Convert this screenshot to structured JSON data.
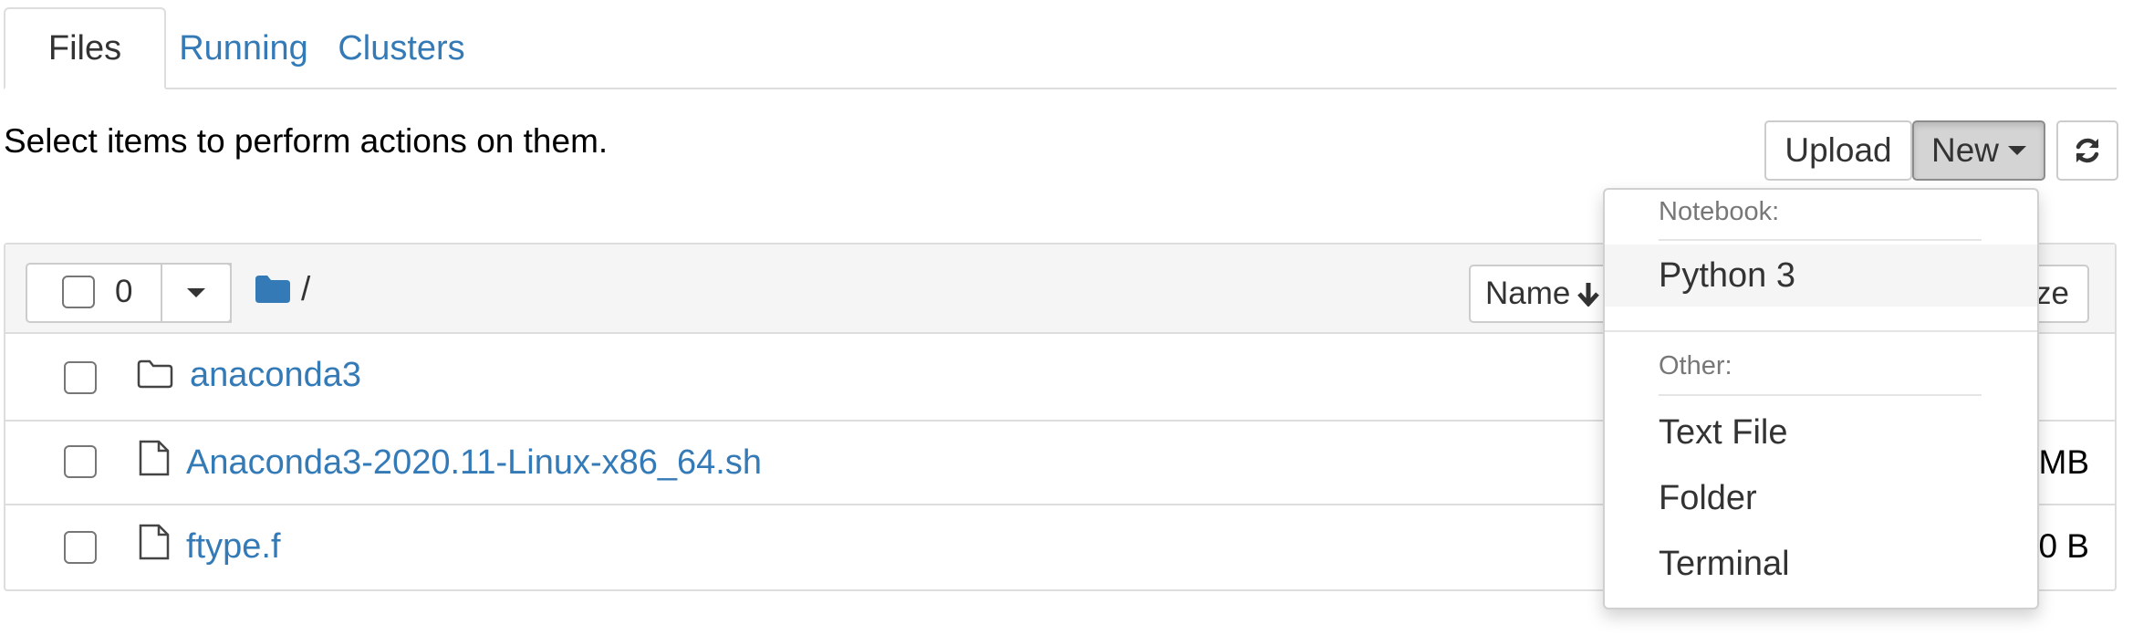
{
  "tabs": [
    {
      "label": "Files",
      "active": true
    },
    {
      "label": "Running",
      "active": false
    },
    {
      "label": "Clusters",
      "active": false
    }
  ],
  "hint": "Select items to perform actions on them.",
  "toolbar": {
    "upload_label": "Upload",
    "new_label": "New",
    "refresh_icon": "refresh-icon"
  },
  "list_header": {
    "selected_count": "0",
    "path": "/",
    "sort_label": "Name",
    "size_label": "ze"
  },
  "files": [
    {
      "name": "anaconda3",
      "type": "folder",
      "size": ""
    },
    {
      "name": "Anaconda3-2020.11-Linux-x86_64.sh",
      "type": "file",
      "size": "MB"
    },
    {
      "name": "ftype.f",
      "type": "file",
      "size": "0 B"
    }
  ],
  "new_menu": {
    "notebook_header": "Notebook:",
    "notebook_items": [
      "Python 3"
    ],
    "other_header": "Other:",
    "other_items": [
      "Text File",
      "Folder",
      "Terminal"
    ]
  },
  "colors": {
    "link": "#337ab7",
    "border": "#dddddd",
    "folder_icon": "#337ab7"
  }
}
